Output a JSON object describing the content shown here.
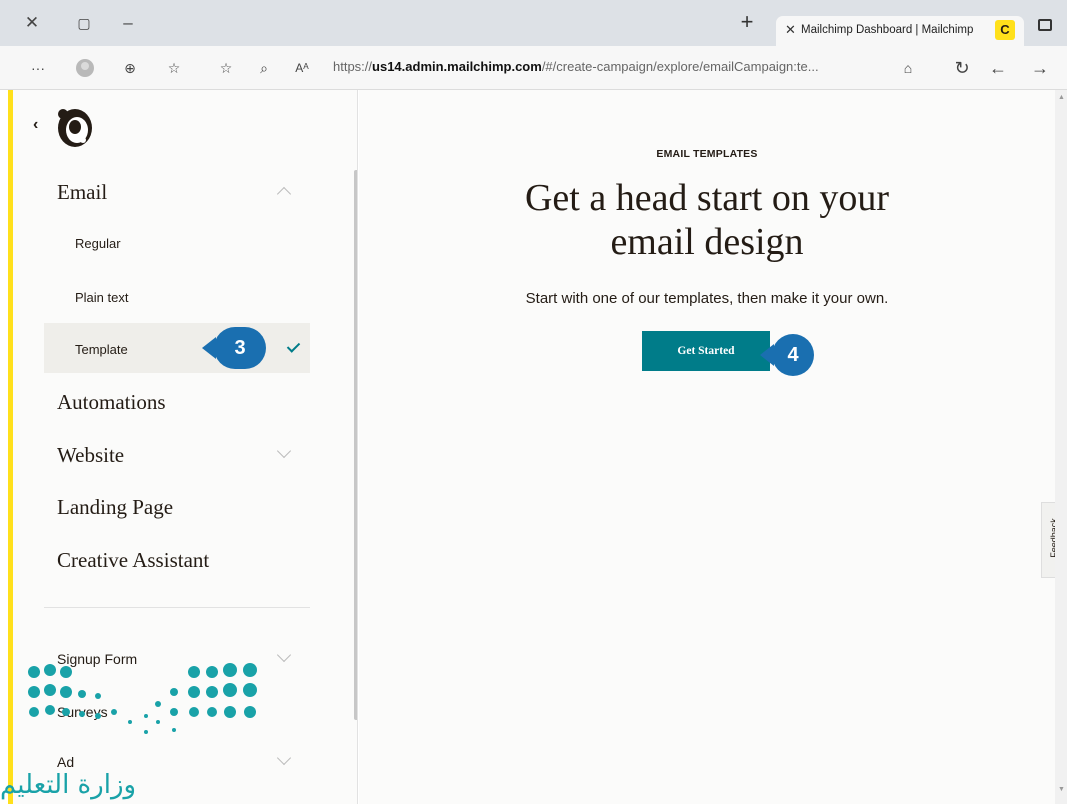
{
  "browser": {
    "tab_title": "Mailchimp Dashboard | Mailchimp",
    "tab_favicon": "C",
    "url_prefix": "https://",
    "url_host": "us14.admin.mailchimp.com",
    "url_path": "/#/create-campaign/explore/emailCampaign:te...",
    "icons": [
      "close-icon",
      "restore-icon",
      "minimize-icon",
      "plus-icon",
      "more-icon",
      "profile-icon",
      "collections-icon",
      "favorites-icon",
      "share-icon",
      "zoom-icon",
      "read-aloud-icon",
      "lock-icon",
      "refresh-icon",
      "back-icon",
      "forward-icon"
    ]
  },
  "sidebar": {
    "email_label": "Email",
    "sub_items": [
      {
        "label": "Regular"
      },
      {
        "label": "Plain text"
      },
      {
        "label": "Template"
      }
    ],
    "items": [
      {
        "label": "Automations"
      },
      {
        "label": "Website"
      },
      {
        "label": "Landing Page"
      },
      {
        "label": "Creative Assistant"
      }
    ],
    "small_items": [
      {
        "label": "Signup Form"
      },
      {
        "label": "Surveys"
      },
      {
        "label": "Ad"
      }
    ]
  },
  "main": {
    "eyebrow": "EMAIL TEMPLATES",
    "headline_line1": "Get a head start on your",
    "headline_line2": "email design",
    "subline": "Start with one of our templates, then make it your own.",
    "cta_label": "Get Started",
    "feedback_label": "Feedback"
  },
  "callouts": {
    "step3": "3",
    "step4": "4"
  },
  "overlay": {
    "ministry_text": "وزارة التعليم"
  },
  "colors": {
    "accent_teal": "#007c89",
    "brand_yellow": "#ffe01b",
    "callout_blue": "#1a6fb0",
    "ministry_green": "#19a2a8"
  }
}
